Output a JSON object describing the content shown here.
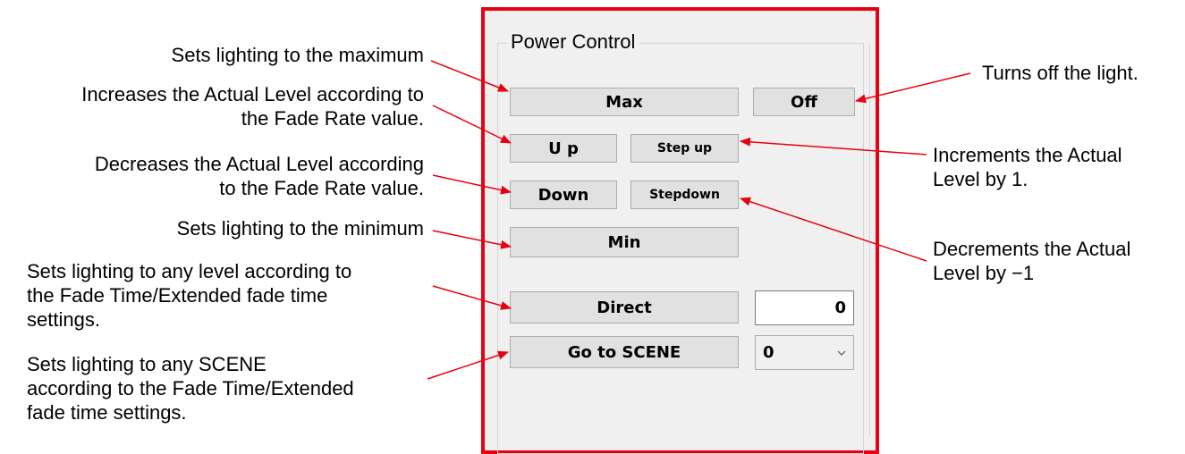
{
  "panel": {
    "title": "Power Control",
    "buttons": {
      "max": "Max",
      "off": "Off",
      "up": "U p",
      "step_up": "Step up",
      "down": "Down",
      "step_down": "Stepdown",
      "min": "Min",
      "direct": "Direct",
      "go_to_scene": "Go to SCENE"
    },
    "direct_value": "0",
    "scene_selected": "0",
    "accent_color": "#e8000f"
  },
  "annotations": {
    "max": [
      "Sets lighting to the maximum"
    ],
    "up": [
      "Increases the Actual Level according to",
      "the Fade Rate value."
    ],
    "down": [
      "Decreases the Actual Level according",
      "to the Fade Rate value."
    ],
    "min": [
      "Sets lighting to the minimum"
    ],
    "direct": [
      "Sets lighting to any level according to",
      "the Fade Time/Extended fade time",
      "settings."
    ],
    "scene": [
      "Sets lighting to any SCENE",
      "according to the Fade Time/Extended",
      "fade time settings."
    ],
    "off": [
      "Turns off the light."
    ],
    "step_up": [
      "Increments the Actual",
      "Level by 1."
    ],
    "step_down": [
      "Decrements the Actual",
      "Level by −1"
    ]
  }
}
